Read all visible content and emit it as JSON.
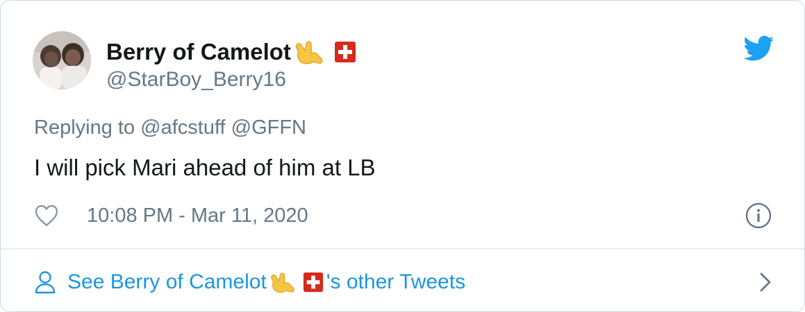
{
  "user": {
    "display_name": "Berry of Camelot",
    "handle": "@StarBoy_Berry16",
    "avatar_icon": "avatar-photo-two-babies",
    "name_emojis": [
      "call-me-hand-emoji",
      "swiss-flag-emoji"
    ]
  },
  "reply": {
    "prefix": "Replying to",
    "mentions": [
      "@afcstuff",
      "@GFFN"
    ]
  },
  "tweet": {
    "text": "I will pick Mari ahead of him at LB",
    "timestamp": "10:08 PM - Mar 11, 2020"
  },
  "footer": {
    "see_prefix": "See Berry of Camelot",
    "see_suffix": "'s other Tweets"
  },
  "icons": {
    "brand": "twitter-bird-icon",
    "like": "heart-icon",
    "info": "info-icon",
    "profile": "person-icon",
    "next": "chevron-right-icon"
  },
  "colors": {
    "twitter_blue": "#1da1f2",
    "link_blue": "#1b95e0",
    "text_primary": "#14171a",
    "text_secondary": "#657786",
    "divider": "#e6ecf0"
  }
}
